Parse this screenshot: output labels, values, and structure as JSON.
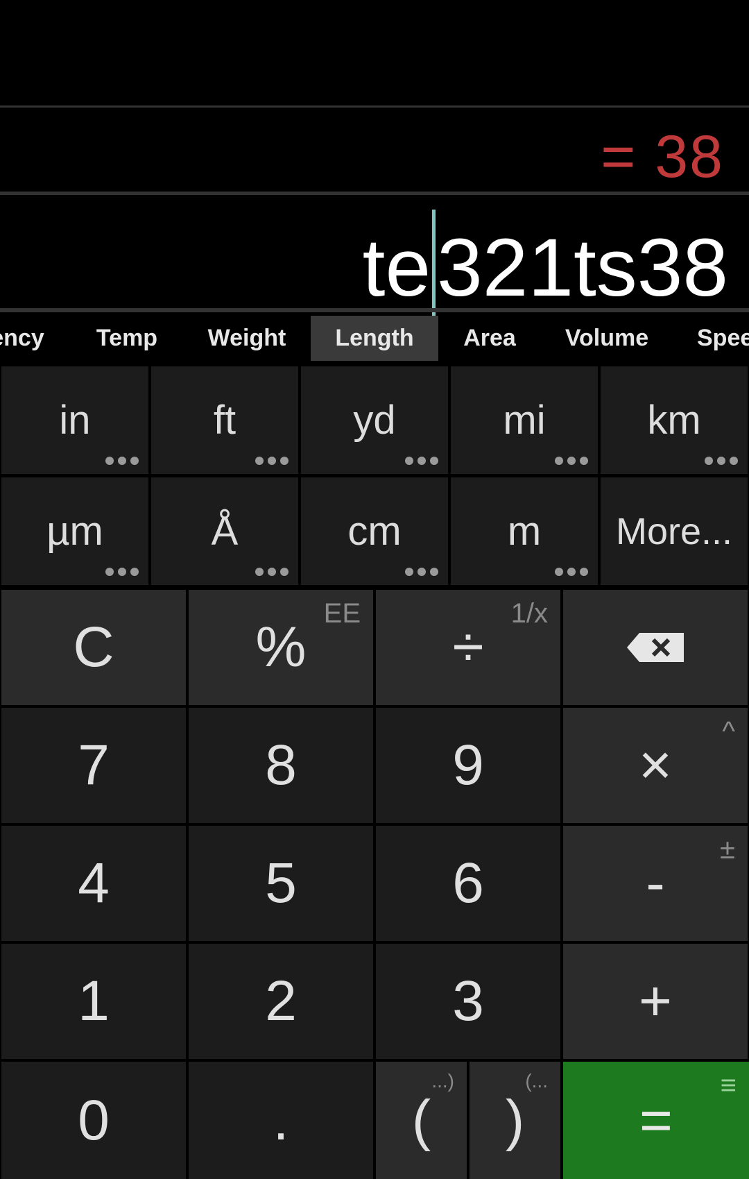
{
  "display": {
    "result": "= 38",
    "expression_before_cursor": "te",
    "expression_after_cursor": "321ts38"
  },
  "unit_tabs": [
    "ency",
    "Temp",
    "Weight",
    "Length",
    "Area",
    "Volume",
    "Spee"
  ],
  "active_tab": "Length",
  "units_row1": [
    "in",
    "ft",
    "yd",
    "mi",
    "km"
  ],
  "units_row2": [
    "µm",
    "Å",
    "cm",
    "m",
    "More..."
  ],
  "keys": {
    "clear": "C",
    "percent": "%",
    "percent_alt": "EE",
    "divide": "÷",
    "divide_alt": "1/x",
    "backspace_icon": "backspace-icon",
    "seven": "7",
    "eight": "8",
    "nine": "9",
    "multiply": "×",
    "multiply_alt": "^",
    "four": "4",
    "five": "5",
    "six": "6",
    "minus": "-",
    "minus_alt": "±",
    "one": "1",
    "two": "2",
    "three": "3",
    "plus": "+",
    "zero": "0",
    "decimal": ".",
    "open_paren": "(",
    "open_paren_alt": "...)",
    "close_paren": ")",
    "close_paren_alt": "(...",
    "equals": "=",
    "equals_alt": "≡"
  },
  "colors": {
    "result": "#c0393b",
    "equals_key": "#1e7a1e",
    "caret": "#7fc7c0"
  }
}
